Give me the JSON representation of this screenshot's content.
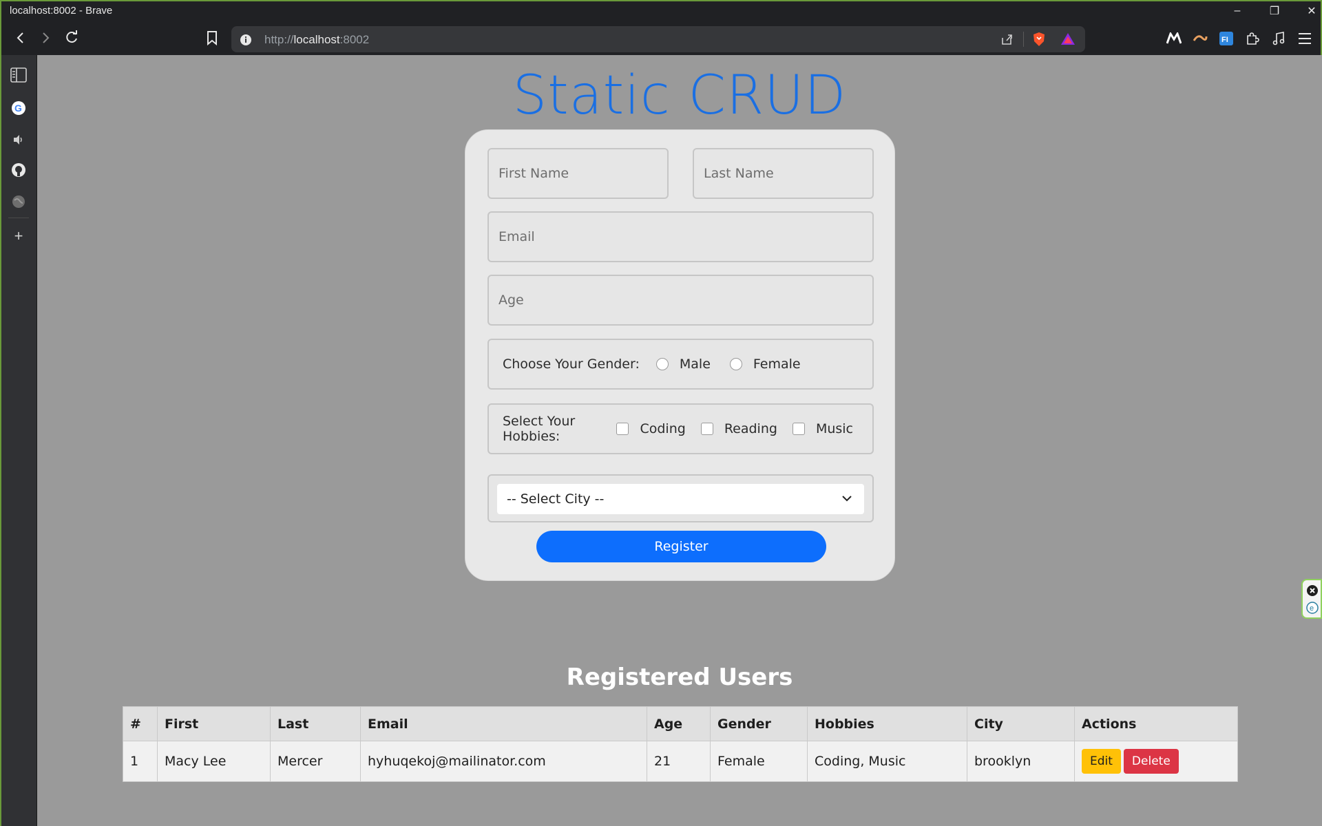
{
  "browser": {
    "window_title": "localhost:8002 - Brave",
    "url_prefix": "http://",
    "url_host": "localhost",
    "url_port": ":8002"
  },
  "page": {
    "heading": "Static CRUD",
    "form": {
      "first_name_placeholder": "First Name",
      "last_name_placeholder": "Last Name",
      "email_placeholder": "Email",
      "age_placeholder": "Age",
      "gender_label": "Choose Your Gender:",
      "gender_options": [
        "Male",
        "Female"
      ],
      "hobbies_label": "Select Your Hobbies:",
      "hobby_options": [
        "Coding",
        "Reading",
        "Music"
      ],
      "city_selected": "-- Select City --",
      "register_label": "Register"
    },
    "users_heading": "Registered Users",
    "table": {
      "headers": [
        "#",
        "First",
        "Last",
        "Email",
        "Age",
        "Gender",
        "Hobbies",
        "City",
        "Actions"
      ],
      "rows": [
        {
          "num": "1",
          "first": "Macy Lee",
          "last": "Mercer",
          "email": "hyhuqekoj@mailinator.com",
          "age": "21",
          "gender": "Female",
          "hobbies": "Coding, Music",
          "city": "brooklyn",
          "edit_label": "Edit",
          "delete_label": "Delete"
        }
      ]
    }
  },
  "colors": {
    "accent": "#1a6fe3",
    "primary_button": "#0d6efd",
    "edit_button": "#ffc107",
    "delete_button": "#dc3545",
    "page_background": "#9a9a9a"
  }
}
